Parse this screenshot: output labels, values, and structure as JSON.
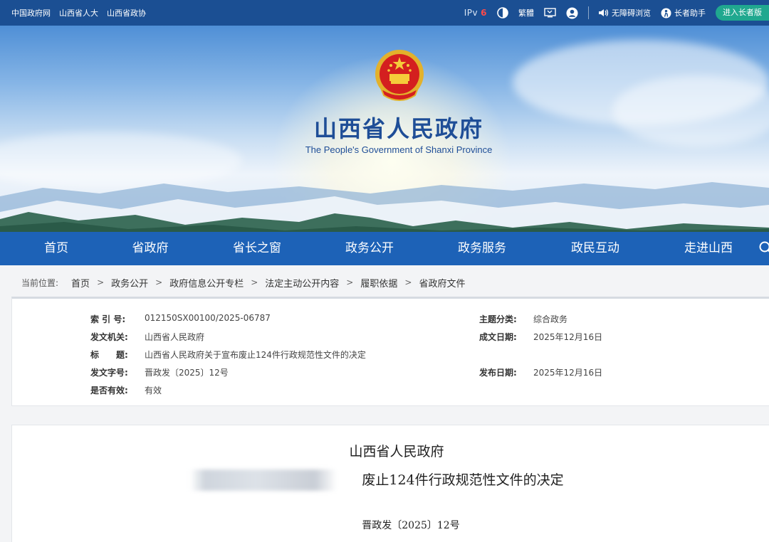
{
  "topbar": {
    "links": [
      "中国政府网",
      "山西省人大",
      "山西省政协"
    ],
    "ipv6_prefix": "IPv",
    "ipv6_suffix": "6",
    "traditional": "繁體",
    "accessible": "无障碍浏览",
    "assistant": "长者助手",
    "elder_mode": "进入长者版"
  },
  "banner": {
    "title": "山西省人民政府",
    "subtitle": "The People's Government of Shanxi Province"
  },
  "nav": {
    "items": [
      "首页",
      "省政府",
      "省长之窗",
      "政务公开",
      "政务服务",
      "政民互动",
      "走进山西"
    ]
  },
  "breadcrumb": {
    "lead": "当前位置:",
    "items": [
      "首页",
      "政务公开",
      "政府信息公开专栏",
      "法定主动公开内容",
      "履职依据",
      "省政府文件"
    ],
    "separator": ">"
  },
  "info": {
    "index_label": "索 引 号:",
    "index_value": "012150SX00100/2025-06787",
    "topic_label": "主题分类:",
    "topic_value": "综合政务",
    "issuer_label": "发文机关:",
    "issuer_value": "山西省人民政府",
    "created_label": "成文日期:",
    "created_value": "2025年12月16日",
    "title_label": "标　　题:",
    "title_value": "山西省人民政府关于宣布废止124件行政规范性文件的决定",
    "docno_label": "发文字号:",
    "docno_value": "晋政发〔2025〕12号",
    "published_label": "发布日期:",
    "published_value": "2025年12月16日",
    "valid_label": "是否有效:",
    "valid_value": "有效"
  },
  "document": {
    "org": "山西省人民政府",
    "title_visible": "废止124件行政规范性文件的决定",
    "doc_number": "晋政发〔2025〕12号"
  },
  "colors": {
    "topbar": "#1b4f93",
    "nav": "#1d62b7",
    "title": "#1f4e97",
    "elder_button": "#20a88f"
  }
}
